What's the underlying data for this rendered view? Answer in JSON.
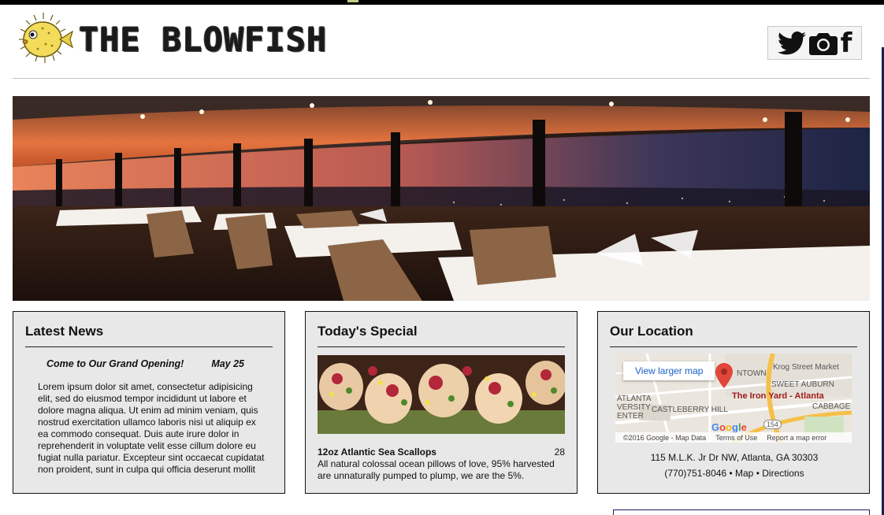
{
  "header": {
    "site_title": "THE BLOWFISH",
    "social_icons": [
      "twitter-icon",
      "camera-icon",
      "facebook-icon"
    ],
    "facebook_glyph": "f"
  },
  "news": {
    "title": "Latest News",
    "headline": "Come to Our Grand Opening!",
    "date": "May 25",
    "body": "Lorem ipsum dolor sit amet, consectetur adipisicing elit, sed do eiusmod tempor incididunt ut labore et dolore magna aliqua. Ut enim ad minim veniam, quis nostrud exercitation ullamco laboris nisi ut aliquip ex ea commodo consequat. Duis aute irure dolor in reprehenderit in voluptate velit esse cillum dolore eu fugiat nulla pariatur. Excepteur sint occaecat cupidatat non proident, sunt in culpa qui officia deserunt mollit anim id est laborum."
  },
  "special": {
    "title": "Today's Special",
    "dish_name": "12oz Atlantic Sea Scallops",
    "price": "28",
    "description": "All natural colossal ocean pillows of love, 95% harvested are unnaturally pumped to plump, we are the 5%."
  },
  "location": {
    "title": "Our Location",
    "map_button": "View larger map",
    "map_place": "The Iron Yard - Atlanta",
    "map_labels": [
      "Krog Street Market",
      "SWEET AUBURN",
      "CASTLEBERRY HILL",
      "CABBAGE",
      "ATLANTA",
      "VERSITY",
      "ENTER",
      "NTOWN",
      "154"
    ],
    "map_footer": [
      "©2016 Google - Map Data",
      "Terms of Use",
      "Report a map error"
    ],
    "address": "115 M.L.K. Jr Dr NW, Atlanta, GA 30303",
    "phone": "(770)751-8046",
    "links": [
      "Map",
      "Directions"
    ],
    "bullet": "•"
  },
  "colors": {
    "card_bg": "#e8e8e8",
    "map_link": "#1a5fc8",
    "pin_red": "#a11d1d"
  }
}
